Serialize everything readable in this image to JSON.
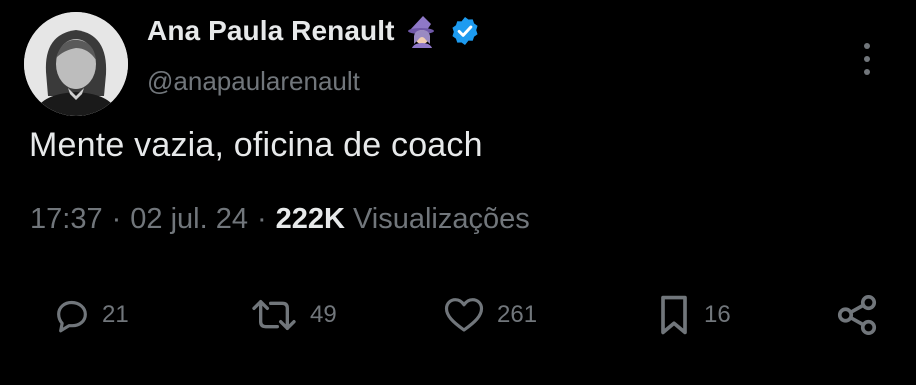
{
  "user": {
    "display_name": "Ana Paula Renault",
    "handle": "@anapaularenault",
    "emoji": "woman-mage-emoji",
    "verified": true
  },
  "tweet": {
    "text": "Mente vazia, oficina de coach",
    "time": "17:37",
    "separator": "·",
    "date": "02 jul. 24",
    "views_count": "222K",
    "views_label": "Visualizações"
  },
  "actions": {
    "replies": "21",
    "retweets": "49",
    "likes": "261",
    "bookmarks": "16"
  },
  "colors": {
    "background": "#000000",
    "primary_text": "#e7e9ea",
    "secondary_text": "#71767b",
    "verified_badge": "#1d9bf0"
  }
}
